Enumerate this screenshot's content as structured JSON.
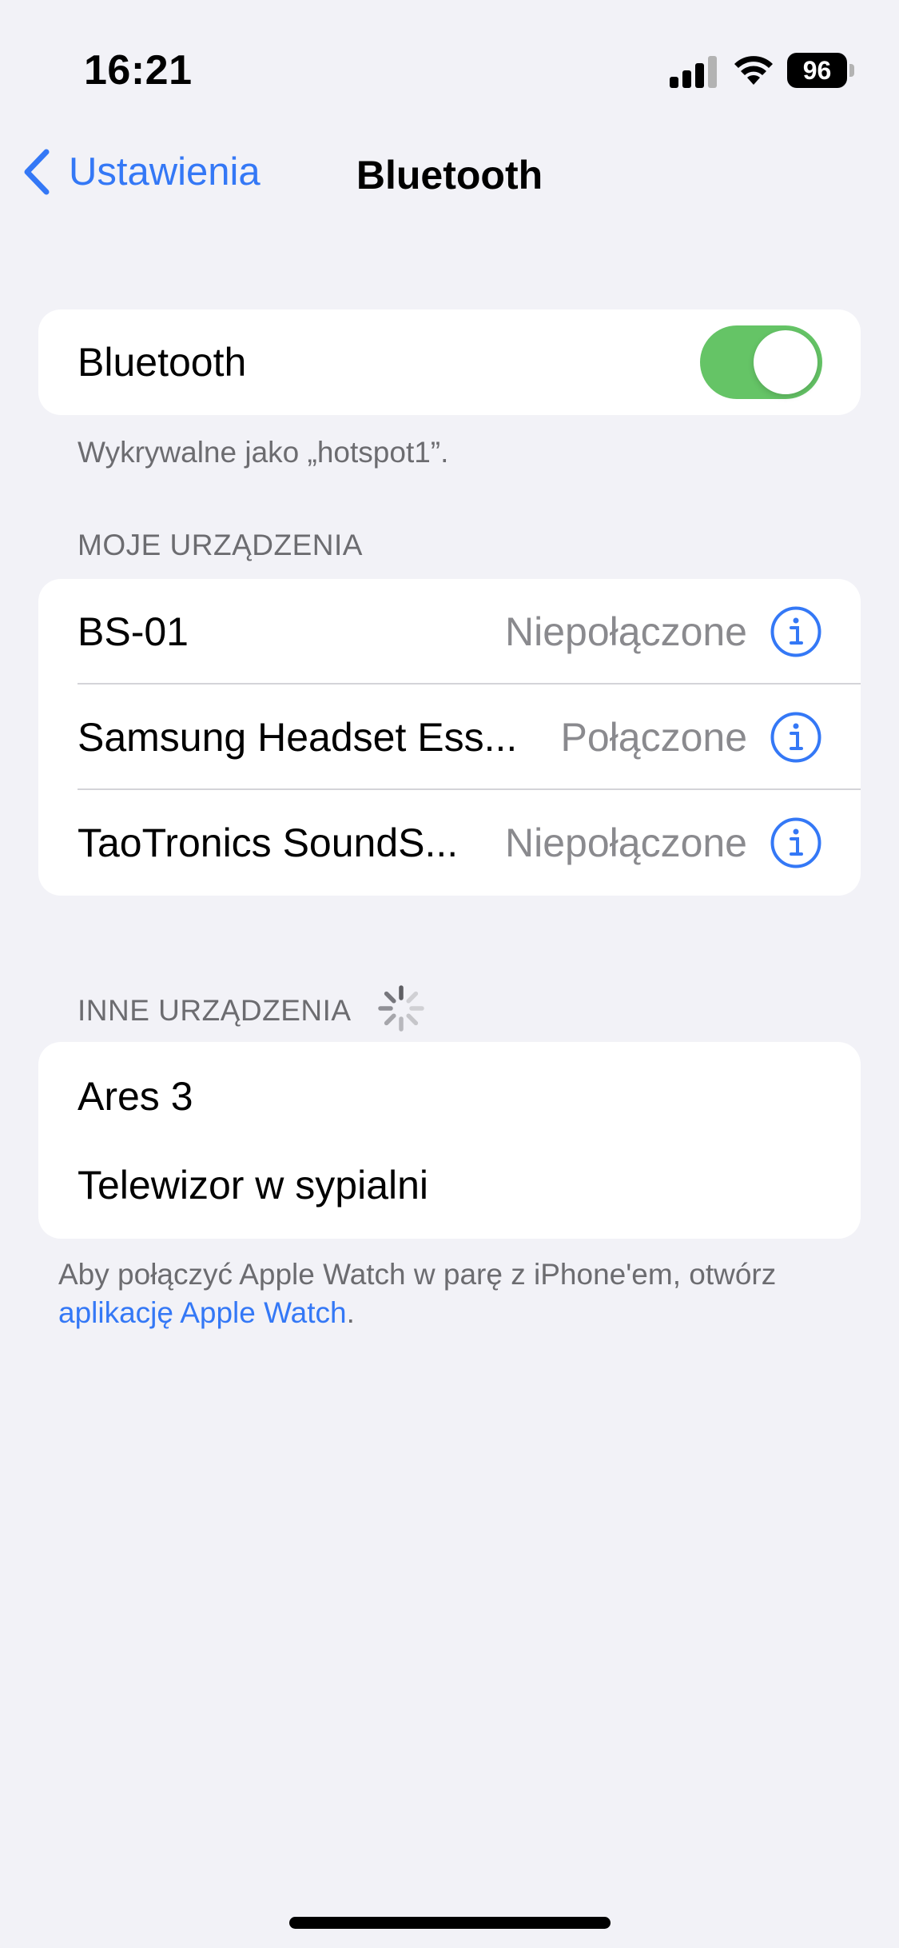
{
  "status_bar": {
    "time": "16:21",
    "battery": "96",
    "icons": [
      "signal-icon",
      "wifi-icon",
      "battery-icon"
    ]
  },
  "nav": {
    "back_label": "Ustawienia",
    "title": "Bluetooth"
  },
  "bluetooth": {
    "label": "Bluetooth",
    "enabled": true,
    "discoverable_note": "Wykrywalne jako „hotspot1”."
  },
  "my_devices": {
    "header": "MOJE URZĄDZENIA",
    "items": [
      {
        "name": "BS-01",
        "status": "Niepołączone"
      },
      {
        "name": "Samsung Headset Ess...",
        "status": "Połączone"
      },
      {
        "name": "TaoTronics SoundS...",
        "status": "Niepołączone"
      }
    ]
  },
  "other_devices": {
    "header": "INNE URZĄDZENIA",
    "items": [
      {
        "name": "Ares 3"
      },
      {
        "name": "Telewizor w sypialni"
      }
    ]
  },
  "watch_note": {
    "text_before": "Aby połączyć Apple Watch w parę z iPhone'em, otwórz ",
    "link": "aplikację Apple Watch",
    "text_after": "."
  },
  "colors": {
    "accent": "#3478f6",
    "toggle_on": "#65c466",
    "background": "#f2f2f7"
  }
}
